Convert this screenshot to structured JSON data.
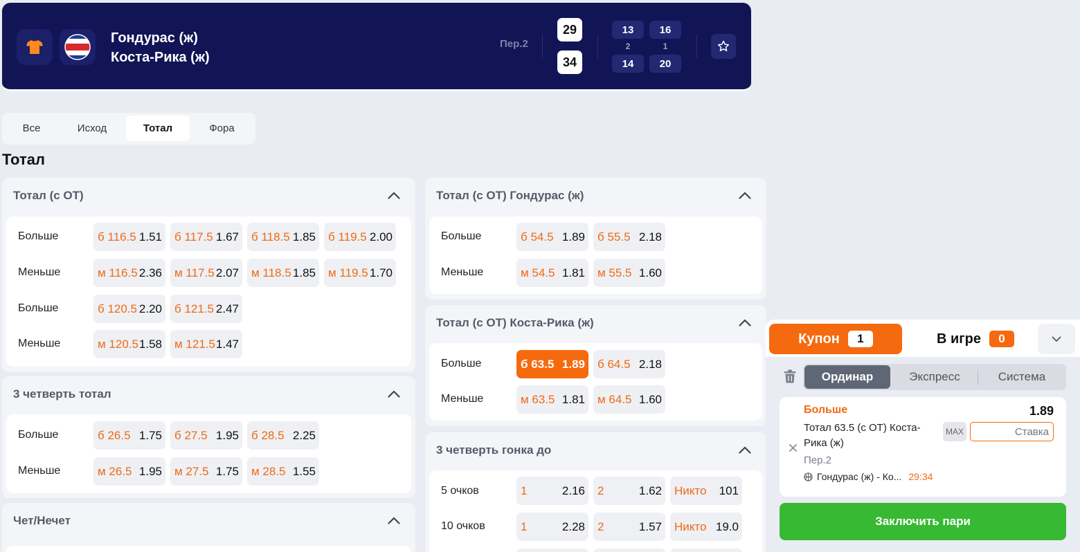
{
  "match": {
    "team1": "Гондурас (ж)",
    "team2": "Коста-Рика (ж)",
    "period": "Пер.2",
    "score1": "29",
    "score2": "34",
    "quarters": [
      {
        "number": "2",
        "team1": "13",
        "team2": "14"
      },
      {
        "number": "1",
        "team1": "16",
        "team2": "20"
      }
    ],
    "icons": [
      "jersey-icon",
      "costa-rica-flag-icon",
      "star-icon"
    ]
  },
  "tabs": [
    "Все",
    "Исход",
    "Тотал",
    "Фора"
  ],
  "active_tab": "Тотал",
  "section_title": "Тотал",
  "markets": {
    "total_ot": {
      "title": "Тотал (с ОТ)",
      "rows": [
        {
          "label": "Больше",
          "odds": [
            {
              "line": "б 116.5",
              "value": "1.51"
            },
            {
              "line": "б 117.5",
              "value": "1.67"
            },
            {
              "line": "б 118.5",
              "value": "1.85"
            },
            {
              "line": "б 119.5",
              "value": "2.00"
            }
          ]
        },
        {
          "label": "Меньше",
          "odds": [
            {
              "line": "м 116.5",
              "value": "2.36"
            },
            {
              "line": "м 117.5",
              "value": "2.07"
            },
            {
              "line": "м 118.5",
              "value": "1.85"
            },
            {
              "line": "м 119.5",
              "value": "1.70"
            }
          ]
        },
        {
          "label": "Больше",
          "odds": [
            {
              "line": "б 120.5",
              "value": "2.20"
            },
            {
              "line": "б 121.5",
              "value": "2.47"
            }
          ]
        },
        {
          "label": "Меньше",
          "odds": [
            {
              "line": "м 120.5",
              "value": "1.58"
            },
            {
              "line": "м 121.5",
              "value": "1.47"
            }
          ]
        }
      ]
    },
    "q3_total": {
      "title": "3 четверть тотал",
      "rows": [
        {
          "label": "Больше",
          "odds": [
            {
              "line": "б 26.5",
              "value": "1.75"
            },
            {
              "line": "б 27.5",
              "value": "1.95"
            },
            {
              "line": "б 28.5",
              "value": "2.25"
            }
          ]
        },
        {
          "label": "Меньше",
          "odds": [
            {
              "line": "м 26.5",
              "value": "1.95"
            },
            {
              "line": "м 27.5",
              "value": "1.75"
            },
            {
              "line": "м 28.5",
              "value": "1.55"
            }
          ]
        }
      ]
    },
    "odd_even": {
      "title": "Чет/Нечет"
    },
    "total_honduras": {
      "title": "Тотал (с ОТ) Гондурас (ж)",
      "rows": [
        {
          "label": "Больше",
          "odds": [
            {
              "line": "б 54.5",
              "value": "1.89"
            },
            {
              "line": "б 55.5",
              "value": "2.18"
            }
          ]
        },
        {
          "label": "Меньше",
          "odds": [
            {
              "line": "м 54.5",
              "value": "1.81"
            },
            {
              "line": "м 55.5",
              "value": "1.60"
            }
          ]
        }
      ]
    },
    "total_costa_rica": {
      "title": "Тотал (с ОТ) Коста-Рика (ж)",
      "rows": [
        {
          "label": "Больше",
          "odds": [
            {
              "line": "б 63.5",
              "value": "1.89",
              "selected": true
            },
            {
              "line": "б 64.5",
              "value": "2.18"
            }
          ]
        },
        {
          "label": "Меньше",
          "odds": [
            {
              "line": "м 63.5",
              "value": "1.81"
            },
            {
              "line": "м 64.5",
              "value": "1.60"
            }
          ]
        }
      ]
    },
    "q3_race": {
      "title": "3 четверть гонка до",
      "rows": [
        {
          "label": "5 очков",
          "odds": [
            {
              "line": "1",
              "value": "2.16"
            },
            {
              "line": "2",
              "value": "1.62"
            },
            {
              "line": "Никто",
              "value": "101"
            }
          ]
        },
        {
          "label": "10 очков",
          "odds": [
            {
              "line": "1",
              "value": "2.28"
            },
            {
              "line": "2",
              "value": "1.57"
            },
            {
              "line": "Никто",
              "value": "19.0"
            }
          ]
        }
      ]
    }
  },
  "coupon": {
    "tab_label": "Купон",
    "tab_count": "1",
    "live_label": "В игре",
    "live_count": "0",
    "bet_types": [
      "Ординар",
      "Экспресс",
      "Система"
    ],
    "active_bet_type": "Ординар",
    "bet": {
      "outcome": "Больше",
      "odds": "1.89",
      "market_line1": "Тотал 63.5 (с ОТ) Коста-",
      "market_line2": "Рика (ж)",
      "period": "Пер.2",
      "event": "Гондурас (ж) - Ко...",
      "time": "29:34",
      "max_label": "MAX",
      "stake_placeholder": "Ставка"
    },
    "place_button": "Заключить пари"
  },
  "colors": {
    "header_bg": "#111556",
    "accent": "#f56a0e",
    "odds_line": "#f06a14",
    "place_button": "#37b933",
    "page_bg": "#e9ecf2"
  }
}
